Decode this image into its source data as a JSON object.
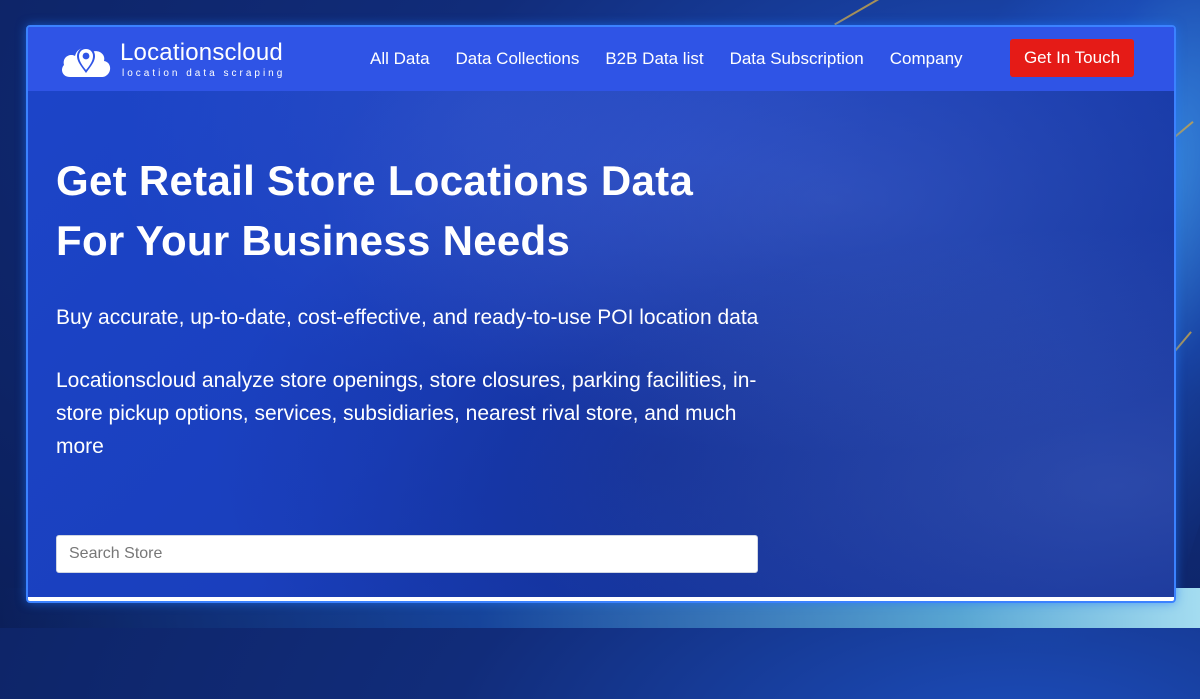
{
  "brand": {
    "name": "Locationscloud",
    "tagline": "location data scraping"
  },
  "nav": {
    "items": [
      "All Data",
      "Data Collections",
      "B2B Data list",
      "Data Subscription",
      "Company"
    ],
    "cta_label": "Get In Touch"
  },
  "hero": {
    "title_line1": "Get Retail Store Locations Data",
    "title_line2": "For Your Business Needs",
    "subtitle": "Buy accurate, up-to-date, cost-effective, and ready-to-use POI location data",
    "description": "Locationscloud analyze store openings, store closures, parking facilities, in-store pickup options, services, subsidiaries, nearest rival store, and much more"
  },
  "search": {
    "placeholder": "Search Store",
    "value": ""
  },
  "colors": {
    "header_bg": "#2f54e6",
    "cta_bg": "#e51b17",
    "hero_bg": "#1a3fbd"
  },
  "icons": {
    "logo": "cloud-location-pin-icon"
  }
}
